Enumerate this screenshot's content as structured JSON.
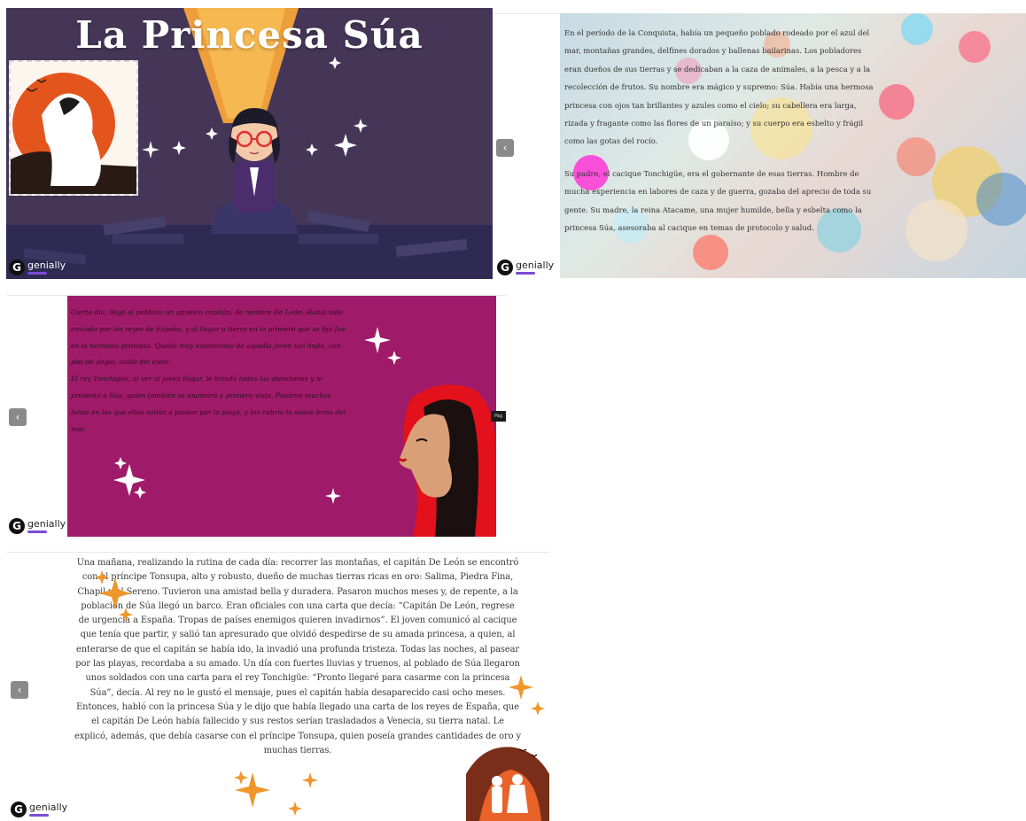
{
  "cover": {
    "title": "La Princesa Súa",
    "colors": {
      "background": "#453658",
      "beam": "#f6a53a",
      "floor": "#2e2a52"
    }
  },
  "branding": {
    "logo_letter": "G",
    "logo_word": "genially"
  },
  "navigation": {
    "prev_symbol": "‹"
  },
  "slide2": {
    "paragraphs": [
      "En el período de la Conquista, había un pequeño poblado rodeado por el azul del mar, montañas grandes, delfines dorados y ballenas bailarinas. Los pobladores eran dueños de sus tierras y se dedicaban a la caza de animales, a la pesca y a la recolección de frutos. Su nombre era mágico y supremo: Súa. Había una hermosa princesa con ojos tan brillantes y azules como el cielo; su cabellera era larga, rizada y fragante como las flores de un paraíso; y su cuerpo era esbelto y frágil como las gotas del rocío.",
      "Su padre, el cacique Tonchigüe, era el gobernante de esas tierras. Hombre de mucha experiencia en labores de caza y de guerra, gozaba del aprecio de toda su gente. Su madre, la reina Atacame, una mujer humilde, bella y esbelta como la princesa Súa, asesoraba al cacique en temas de protocolo y salud."
    ]
  },
  "slide3": {
    "paragraphs": [
      "Cierto día, llegó al poblado un apuesto capitán, de nombre De León. Había sido enviado por los reyes de España, y al llegar a tierra en lo primero que se fijó fue en la hermosa princesa. Quedó muy enamorado de aquella joven tan linda, con piel de ángel, caída del cielo.",
      "El rey Tonchigüe, al ver al joven llegar, le brindó todas las atenciones y le presentó a Súa, quien también se enamoró a primera vista. Pasaron muchas lunas en las que ellos salían a pasear por la playa, y los cubría la suave brisa del mar."
    ],
    "side_tag": "Pág",
    "colors": {
      "background": "#9f1b69",
      "hood": "#e3111b"
    }
  },
  "slide4": {
    "paragraph": "Una mañana, realizando la rutina de cada día: recorrer las montañas, el capitán De León se encontró con el príncipe Tonsupa, alto y robusto, dueño de muchas tierras ricas en oro: Salima, Piedra Fina, Chapil y el Sereno. Tuvieron una amistad bella y duradera. Pasaron muchos meses y, de repente, a la población de Súa llegó un barco. Eran oficiales con una carta que decía: “Capitán De León, regrese de urgencia a España. Tropas de países enemigos quieren invadirnos”. El joven comunicó al cacique que tenía que partir, y salió tan apresurado que olvidó despedirse de su amada princesa, a quien, al enterarse de que el capitán se había ido, la invadió una profunda tristeza. Todas las noches, al pasear por las playas, recordaba a su amado. Un día con fuertes lluvias y truenos, al poblado de Súa llegaron unos soldados con una carta para el rey Tonchigüe: “Pronto llegaré para casarme con la princesa Súa”, decía. Al rey no le gustó el mensaje, pues el capitán había desaparecido casi ocho meses. Entonces, habló con la princesa Súa y le dijo que había llegado una carta de los reyes de España, que el capitán De León había fallecido y sus restos serían trasladados a Venecia, su tierra natal. Le explicó, además, que debía casarse con el príncipe Tonsupa, quien poseía grandes cantidades de oro y muchas tierras.",
    "colors": {
      "sparkle": "#f0962a"
    }
  }
}
